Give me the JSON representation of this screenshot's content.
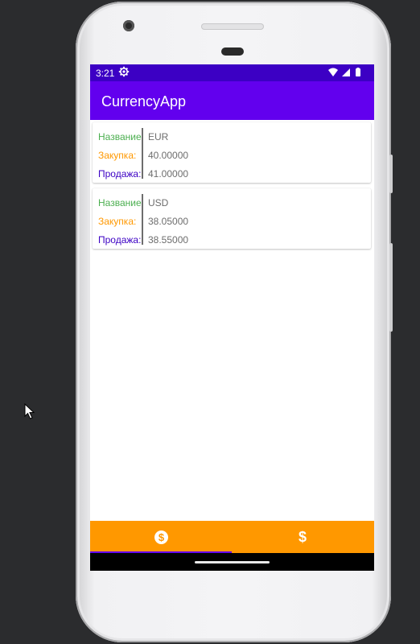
{
  "status_bar": {
    "time": "3:21"
  },
  "app_bar": {
    "title": "CurrencyApp"
  },
  "currency_list": {
    "labels": {
      "name": "Название",
      "buy": "Закупка:",
      "sell": "Продажа:"
    },
    "items": [
      {
        "name": "EUR",
        "buy": "40.00000",
        "sell": "41.00000"
      },
      {
        "name": "USD",
        "buy": "38.05000",
        "sell": "38.55000"
      }
    ]
  },
  "bottom_nav": {
    "items": [
      {
        "icon": "dollar-circle-icon",
        "selected": true
      },
      {
        "icon": "dollar-icon",
        "selected": false
      }
    ]
  },
  "colors": {
    "status_bar": "#3c00c4",
    "app_bar": "#6200ee",
    "bottom_nav": "#ff9800",
    "label_name": "#4caf50",
    "label_buy": "#ff9800",
    "label_sell": "#3c00c4",
    "value_text": "#6d6d6d"
  }
}
